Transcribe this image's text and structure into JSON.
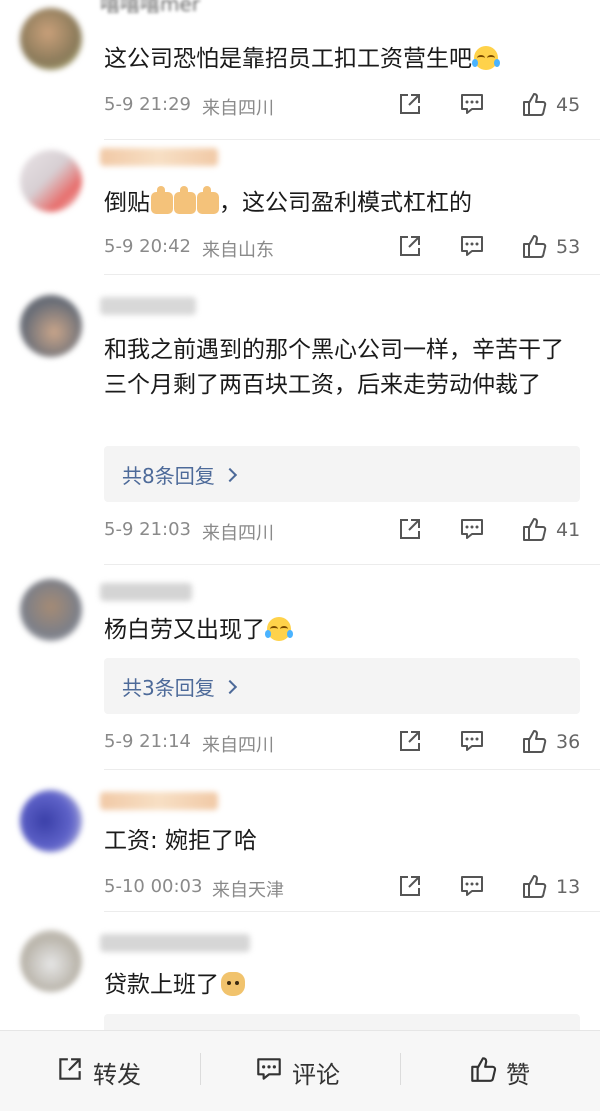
{
  "comments": [
    {
      "username": "嘻嘻嘻mer",
      "text": "这公司恐怕是靠招员工扣工资营生吧",
      "emoji": "laugh-cry-emoji",
      "time": "5-9 21:29",
      "location": "来自四川",
      "likes": "45"
    },
    {
      "text": "倒贴",
      "text2": "，这公司盈利模式杠杠的",
      "emoji": "thumbs-up-emoji",
      "time": "5-9 20:42",
      "location": "来自山东",
      "likes": "53"
    },
    {
      "text": "和我之前遇到的那个黑心公司一样，辛苦干了三个月剩了两百块工资，后来走劳动仲裁了",
      "replies": "共8条回复",
      "time": "5-9 21:03",
      "location": "来自四川",
      "likes": "41"
    },
    {
      "text": "杨白劳又出现了",
      "emoji": "laugh-cry-emoji",
      "replies": "共3条回复",
      "time": "5-9 21:14",
      "location": "来自四川",
      "likes": "36"
    },
    {
      "text": "工资: 婉拒了哈",
      "time": "5-10 00:03",
      "location": "来自天津",
      "likes": "13"
    },
    {
      "text": "贷款上班了",
      "emoji": "doge-emoji"
    }
  ],
  "toolbar": {
    "repost": "转发",
    "comment": "评论",
    "like": "赞"
  },
  "icons": {
    "share": "share-icon",
    "reply": "comment-icon",
    "like": "thumbs-up-icon"
  },
  "colors": {
    "reply_link": "#4d6a99",
    "meta": "#8a8a8a"
  }
}
